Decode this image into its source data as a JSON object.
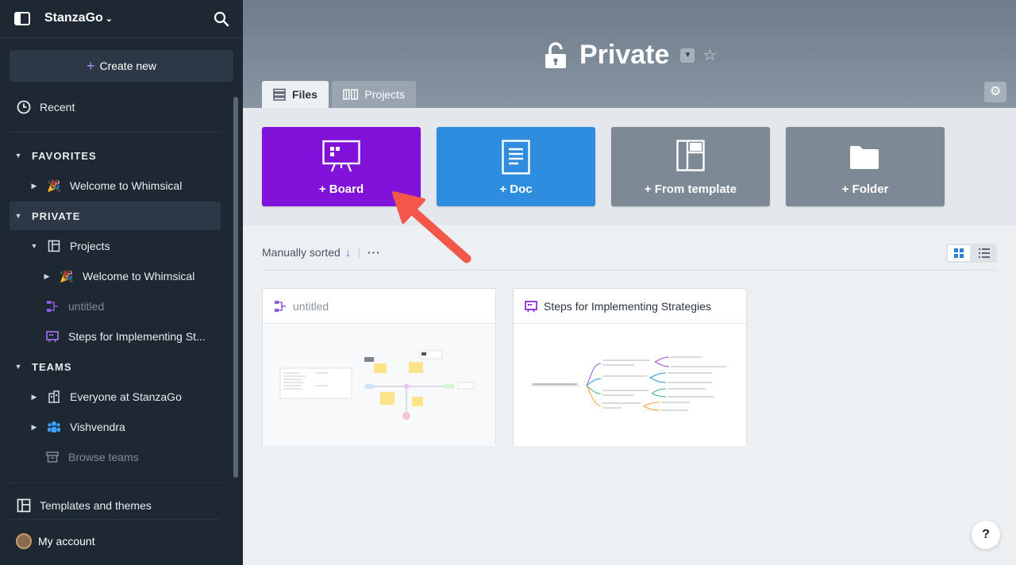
{
  "sidebar": {
    "brand": "StanzaGo",
    "create_new": "Create new",
    "recent": "Recent",
    "favorites_label": "FAVORITES",
    "favorites_item": "Welcome to Whimsical",
    "private_label": "PRIVATE",
    "projects": "Projects",
    "projects_child": "Welcome to Whimsical",
    "untitled": "untitled",
    "steps": "Steps for Implementing St...",
    "teams_label": "TEAMS",
    "team_everyone": "Everyone at StanzaGo",
    "team_vish": "Vishvendra",
    "browse_teams": "Browse teams",
    "templates": "Templates and themes",
    "my_account": "My account"
  },
  "header": {
    "title": "Private",
    "tabs": [
      {
        "label": "Files"
      },
      {
        "label": "Projects"
      }
    ]
  },
  "create_cards": [
    {
      "label": "+ Board",
      "color": "#8012d9"
    },
    {
      "label": "+ Doc",
      "color": "#2e8ddf"
    },
    {
      "label": "+ From template",
      "color": "#7d8995"
    },
    {
      "label": "+ Folder",
      "color": "#7d8995"
    }
  ],
  "sort": {
    "label": "Manually sorted",
    "arrow": "↓",
    "more": "···"
  },
  "files": [
    {
      "name": "untitled"
    },
    {
      "name": "Steps for Implementing Strategies"
    }
  ],
  "help": "?"
}
